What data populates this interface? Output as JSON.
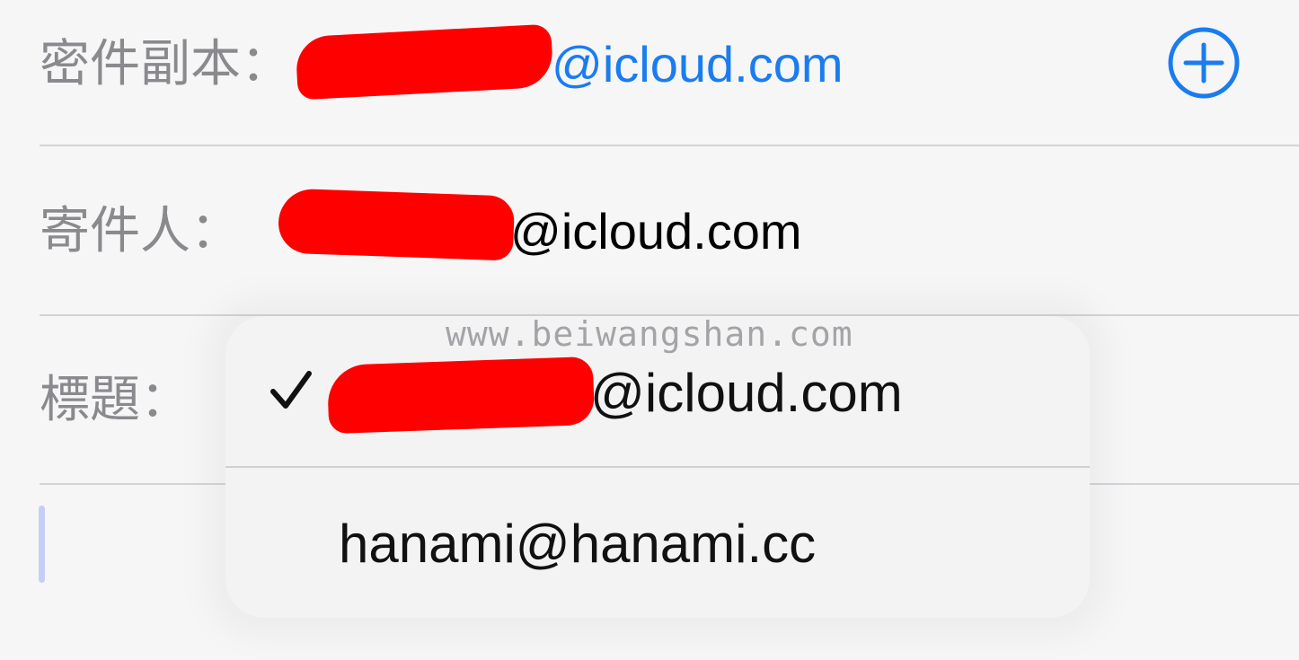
{
  "bcc": {
    "label": "密件副本：",
    "value": "@icloud.com",
    "add_icon": "plus-circle-icon"
  },
  "from": {
    "label": "寄件人：",
    "value": "@icloud.com"
  },
  "subject": {
    "label": "標題："
  },
  "sender_menu": {
    "options": [
      {
        "label": "@icloud.com",
        "selected": true,
        "icon": "checkmark-icon"
      },
      {
        "label": "hanami@hanami.cc",
        "selected": false
      }
    ]
  },
  "watermark": "www.beiwangshan.com",
  "colors": {
    "accent": "#1a7cf0",
    "label": "#8a8a8e",
    "redaction": "#ff0000"
  }
}
